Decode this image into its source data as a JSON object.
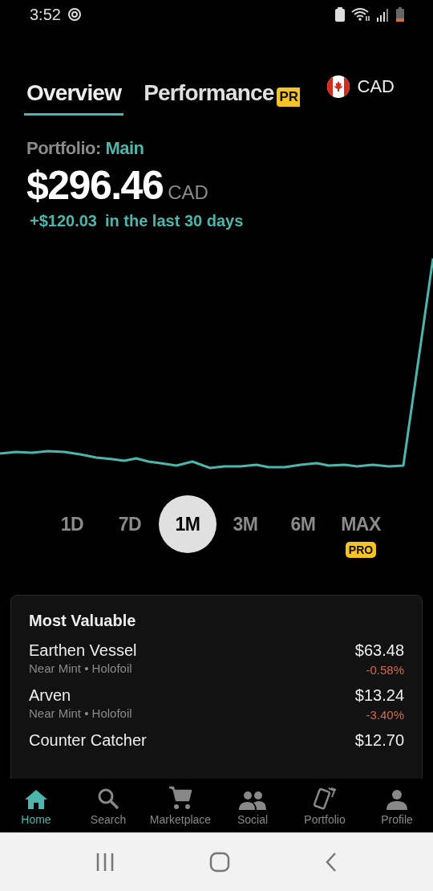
{
  "status_bar": {
    "time": "3:52"
  },
  "tabs": [
    {
      "label": "Overview",
      "selected": true
    },
    {
      "label": "Performance",
      "selected": false,
      "badge": "PR"
    }
  ],
  "currency": {
    "code": "CAD"
  },
  "portfolio": {
    "label": "Portfolio:",
    "name": "Main",
    "value": "$296.46",
    "currency": "CAD",
    "change": "+$120.03",
    "period": "in the last 30 days"
  },
  "ranges": [
    {
      "label": "1D",
      "selected": false
    },
    {
      "label": "7D",
      "selected": false
    },
    {
      "label": "1M",
      "selected": true
    },
    {
      "label": "3M",
      "selected": false
    },
    {
      "label": "6M",
      "selected": false
    },
    {
      "label": "MAX",
      "selected": false,
      "badge": "PRO"
    }
  ],
  "most_valuable": {
    "title": "Most Valuable",
    "items": [
      {
        "name": "Earthen Vessel",
        "details": "Near Mint • Holofoil",
        "price": "$63.48",
        "change": "-0.58%"
      },
      {
        "name": "Arven",
        "details": "Near Mint • Holofoil",
        "price": "$13.24",
        "change": "-3.40%"
      },
      {
        "name": "Counter Catcher",
        "price": "$12.70"
      }
    ]
  },
  "nav": [
    {
      "label": "Home",
      "selected": true
    },
    {
      "label": "Search",
      "selected": false
    },
    {
      "label": "Marketplace",
      "selected": false
    },
    {
      "label": "Social",
      "selected": false
    },
    {
      "label": "Portfolio",
      "selected": false
    },
    {
      "label": "Profile",
      "selected": false
    }
  ]
}
